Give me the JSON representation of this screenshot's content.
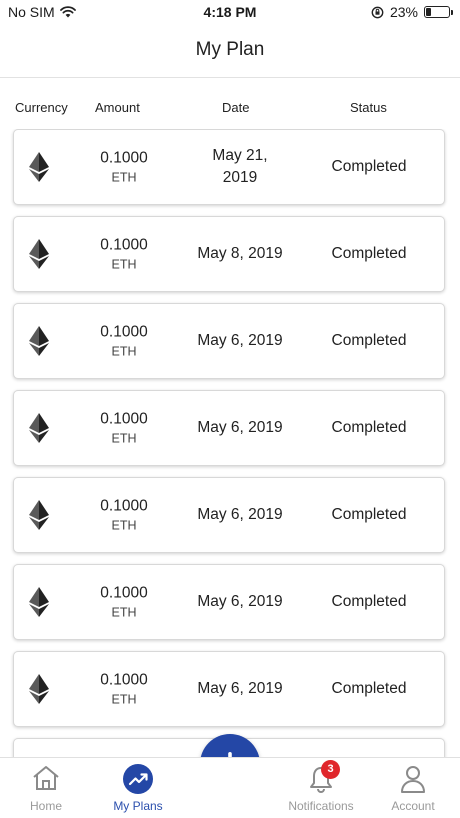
{
  "status_bar": {
    "carrier": "No SIM",
    "time": "4:18 PM",
    "battery_pct": "23%",
    "battery_level": 0.23
  },
  "header": {
    "title": "My Plan"
  },
  "columns": {
    "currency": "Currency",
    "amount": "Amount",
    "date": "Date",
    "status": "Status"
  },
  "plans": [
    {
      "currency_icon": "ethereum-icon",
      "amount": "0.1000",
      "unit": "ETH",
      "date": "May 21, 2019",
      "status": "Completed"
    },
    {
      "currency_icon": "ethereum-icon",
      "amount": "0.1000",
      "unit": "ETH",
      "date": "May 8, 2019",
      "status": "Completed"
    },
    {
      "currency_icon": "ethereum-icon",
      "amount": "0.1000",
      "unit": "ETH",
      "date": "May 6, 2019",
      "status": "Completed"
    },
    {
      "currency_icon": "ethereum-icon",
      "amount": "0.1000",
      "unit": "ETH",
      "date": "May 6, 2019",
      "status": "Completed"
    },
    {
      "currency_icon": "ethereum-icon",
      "amount": "0.1000",
      "unit": "ETH",
      "date": "May 6, 2019",
      "status": "Completed"
    },
    {
      "currency_icon": "ethereum-icon",
      "amount": "0.1000",
      "unit": "ETH",
      "date": "May 6, 2019",
      "status": "Completed"
    },
    {
      "currency_icon": "ethereum-icon",
      "amount": "0.1000",
      "unit": "ETH",
      "date": "May 6, 2019",
      "status": "Completed"
    }
  ],
  "tabbar": {
    "home": "Home",
    "plans": "My Plans",
    "notifications": "Notifications",
    "notifications_badge": "3",
    "account": "Account"
  },
  "colors": {
    "accent": "#2447a6",
    "badge": "#e0262b",
    "inactive": "#9a9a9a"
  }
}
